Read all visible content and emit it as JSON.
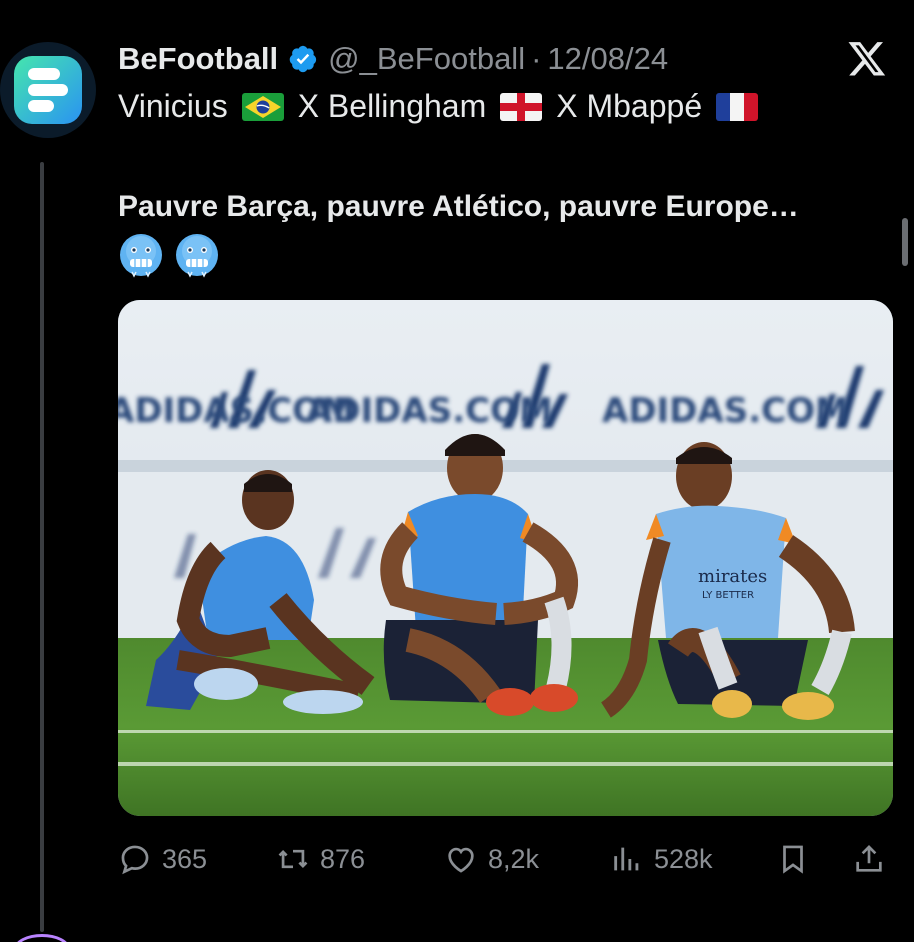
{
  "tweet": {
    "author_name": "BeFootball",
    "handle": "@_BeFootball",
    "separator": "·",
    "date": "12/08/24",
    "line1": {
      "part1": "Vinicius",
      "part2": "X Bellingham",
      "part3": "X Mbappé"
    },
    "line2": "Pauvre Barça, pauvre Atlético, pauvre Europe…",
    "emojis": [
      "cold-face-emoji",
      "cold-face-emoji"
    ],
    "image": {
      "banner_text": "ADIDAS.COM",
      "shirt_text": "mirates",
      "shirt_subtext": "LY BETTER"
    }
  },
  "actions": {
    "replies": "365",
    "retweets": "876",
    "likes": "8,2k",
    "views": "528k"
  },
  "icons": {
    "avatar": "befootball-logo-icon",
    "verified": "verified-badge-icon",
    "platform": "x-logo-icon",
    "reply": "reply-icon",
    "retweet": "retweet-icon",
    "like": "heart-icon",
    "views": "views-icon",
    "bookmark": "bookmark-icon",
    "share": "share-icon"
  },
  "colors": {
    "background": "#000000",
    "text": "#e7e9ea",
    "muted": "#8b8f94",
    "verified": "#1d9bf0",
    "brand_gradient_start": "#3ee0b0",
    "brand_gradient_end": "#2f8cf0"
  }
}
